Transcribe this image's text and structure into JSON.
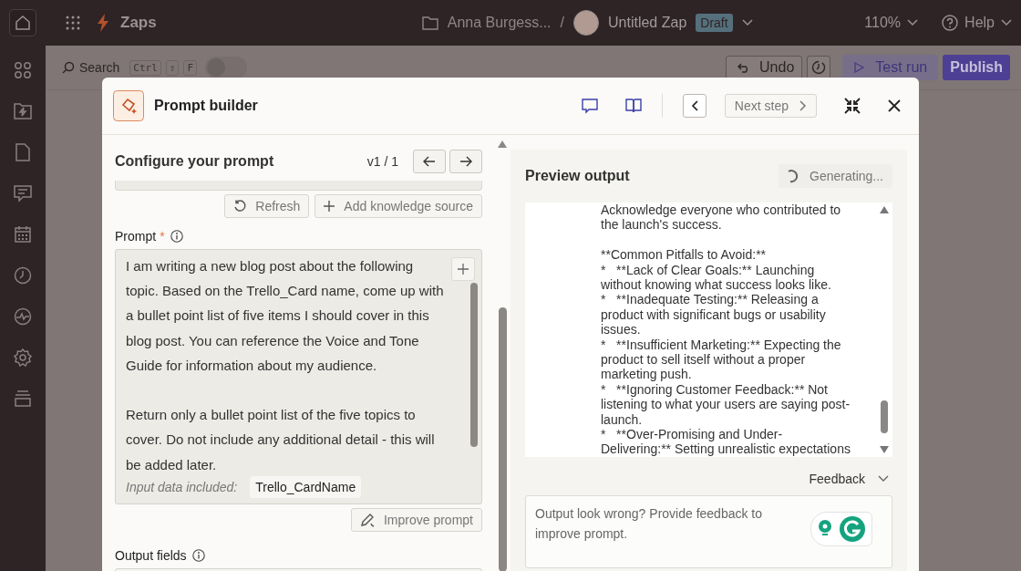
{
  "topbar": {
    "app_name": "Zaps",
    "folder": "Anna Burgess...",
    "separator": "/",
    "zap_title": "Untitled Zap",
    "status_badge": "Draft",
    "zoom": "110%",
    "help": "Help"
  },
  "canvas_toolbar": {
    "search": "Search",
    "shortcut_keys": [
      "Ctrl",
      "⇧",
      "F"
    ],
    "toggle": {
      "on": false
    },
    "undo": "Undo",
    "test_run": "Test run",
    "publish": "Publish"
  },
  "modal": {
    "title": "Prompt builder",
    "next_step": "Next step",
    "configure": {
      "heading": "Configure your prompt",
      "version": "v1 / 1",
      "refresh": "Refresh",
      "add_knowledge": "Add knowledge source",
      "prompt_label": "Prompt",
      "required_mark": "*",
      "prompt_text": "I am writing a new blog post about the following topic. Based on the Trello_Card name, come up with a bullet point list of five items I should cover in this blog post. You can reference the Voice and Tone Guide for information about my audience.\n\nReturn only a bullet point list of the five topics to cover. Do not include any additional detail - this will be added later.",
      "input_data_label": "Input data included:",
      "input_chips": [
        "Trello_CardName"
      ],
      "improve": "Improve prompt",
      "output_fields_label": "Output fields"
    },
    "preview": {
      "heading": "Preview output",
      "status": "Generating...",
      "output_blocks": [
        [
          "Acknowledge everyone who contributed to",
          "the launch's success."
        ],
        [
          "**Common Pitfalls to Avoid:**",
          "*   **Lack of Clear Goals:** Launching",
          "without knowing what success looks like.",
          "*   **Inadequate Testing:** Releasing a",
          "product with significant bugs or usability",
          "issues.",
          "*   **Insufficient Marketing:** Expecting the",
          "product to sell itself without a proper",
          "marketing push.",
          "*   **Ignoring Customer Feedback:** Not",
          "listening to what your users are saying post-",
          "launch.",
          "*   **Over-Promising and Under-",
          "Delivering:** Setting unrealistic expectations"
        ]
      ],
      "feedback_toggle": "Feedback",
      "feedback_placeholder": "Output look wrong? Provide feedback to improve prompt."
    }
  }
}
